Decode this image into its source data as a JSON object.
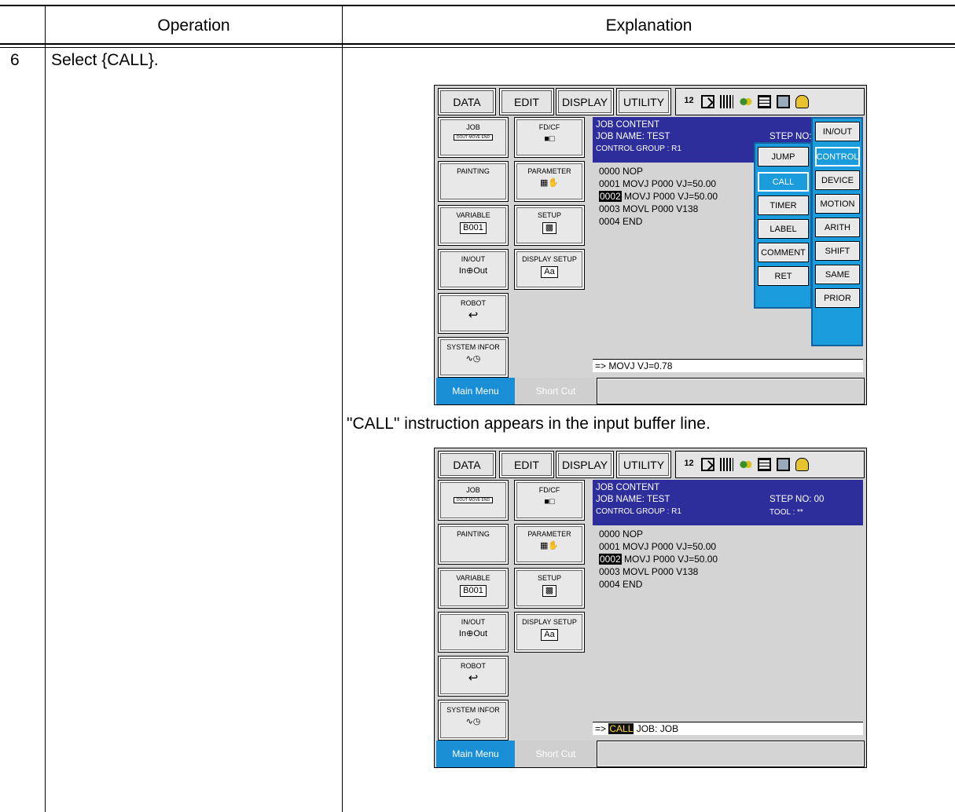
{
  "table": {
    "header_operation": "Operation",
    "header_explanation": "Explanation",
    "step_number": "6",
    "step_operation": "Select {CALL}.",
    "caption": "\"CALL\" instruction appears in the input buffer line."
  },
  "pendant": {
    "menu_data": "DATA",
    "menu_edit": "EDIT",
    "menu_display": "DISPLAY",
    "menu_utility": "UTILITY",
    "status_icon_1": "12",
    "main_menu_items": {
      "job": "JOB",
      "job_icon_text": "DOUT MOVE END",
      "fdcf": "FD/CF",
      "painting": "PAINTING",
      "parameter": "PARAMETER",
      "variable": "VARIABLE",
      "variable_value": "B001",
      "setup": "SETUP",
      "inout": "IN/OUT",
      "inout_in": "In",
      "inout_out": "Out",
      "display_setup": "DISPLAY SETUP",
      "display_setup_icon": "Aa",
      "robot": "ROBOT",
      "system_info": "SYSTEM INFOR"
    },
    "job_header": {
      "title": "JOB CONTENT",
      "job_name": "JOB NAME: TEST",
      "control_group": "CONTROL GROUP : R1",
      "step_no": "STEP NO: 00",
      "step_no_partial": "STEP NO: 0",
      "tool": "TOOL : **"
    },
    "job_lines": [
      {
        "num": "0000",
        "text": " NOP"
      },
      {
        "num": "0001",
        "text": " MOVJ P000 VJ=50.00"
      },
      {
        "num": "0002",
        "text": " MOVJ P000 VJ=50.00"
      },
      {
        "num": "0003",
        "text": " MOVL P000 V138"
      },
      {
        "num": "0004",
        "text": " END"
      }
    ],
    "side_menu": [
      "IN/OUT",
      "CONTROL",
      "DEVICE",
      "MOTION",
      "ARITH",
      "SHIFT",
      "SAME",
      "PRIOR"
    ],
    "control_submenu": [
      "JUMP",
      "CALL",
      "TIMER",
      "LABEL",
      "COMMENT",
      "RET"
    ],
    "buffer_before": {
      "prompt": "=>",
      "text": " MOVJ  VJ=0.78"
    },
    "buffer_after": {
      "prompt": "=>",
      "keyword": "CALL",
      "text": " JOB: JOB"
    },
    "bottom_main_menu": "Main Menu",
    "bottom_short_cut": "Short Cut"
  }
}
